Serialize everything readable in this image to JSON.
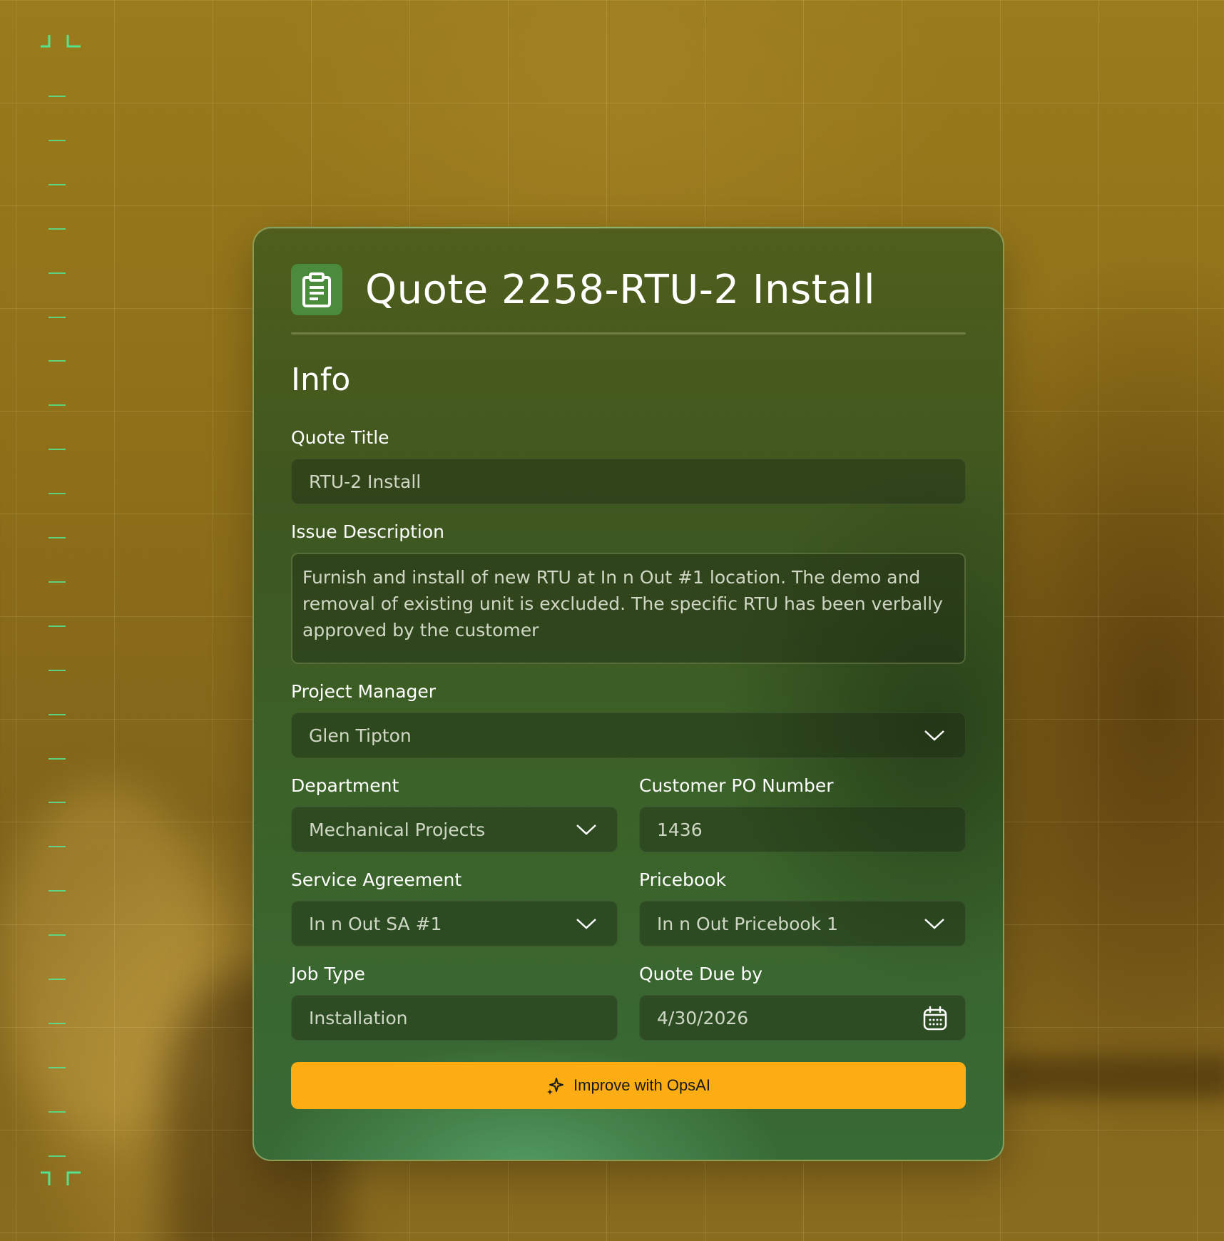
{
  "card": {
    "title": "Quote 2258-RTU-2 Install",
    "section": "Info"
  },
  "fields": {
    "quote_title": {
      "label": "Quote Title",
      "value": "RTU-2 Install"
    },
    "issue_description": {
      "label": "Issue Description",
      "value": "Furnish and install of new RTU at In n Out #1 location. The demo and removal of existing unit is excluded. The specific RTU has been verbally approved by the customer"
    },
    "project_manager": {
      "label": "Project Manager",
      "value": "Glen Tipton"
    },
    "department": {
      "label": "Department",
      "value": "Mechanical Projects"
    },
    "customer_po": {
      "label": "Customer PO Number",
      "value": "1436"
    },
    "service_agreement": {
      "label": "Service Agreement",
      "value": "In n Out SA #1"
    },
    "pricebook": {
      "label": "Pricebook",
      "value": "In n Out Pricebook 1"
    },
    "job_type": {
      "label": "Job Type",
      "value": "Installation"
    },
    "quote_due": {
      "label": "Quote Due by",
      "value": "4/30/2026"
    }
  },
  "actions": {
    "improve_label": "Improve with OpsAI"
  },
  "colors": {
    "accent_button": "#fcad14",
    "ruler_green": "#55e38f",
    "icon_bg": "#4a8c3c"
  },
  "icons": {
    "header": "clipboard-icon",
    "dropdown": "chevron-down-icon",
    "date": "calendar-icon",
    "ai": "sparkle-icon"
  }
}
